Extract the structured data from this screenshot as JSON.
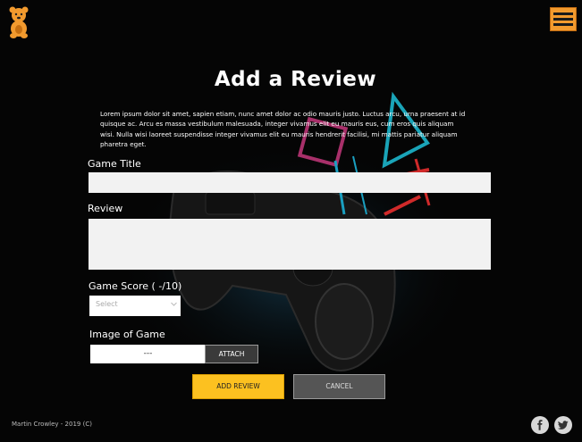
{
  "header": {
    "logo_icon": "bear-logo-icon",
    "menu_icon": "hamburger-menu-icon",
    "accent_color": "#f29a2e"
  },
  "page": {
    "title": "Add a Review",
    "intro": "Lorem ipsum dolor sit amet, sapien etiam, nunc amet dolor ac odio mauris justo. Luctus arcu, urna praesent at id quisque ac. Arcu es massa vestibulum malesuada, integer vivamus elit eu mauris eus, cum eros quis aliquam wisi. Nulla wisi laoreet suspendisse integer vivamus elit eu mauris hendrerit facilisi, mi mattis pariatur aliquam pharetra eget."
  },
  "form": {
    "game_title_label": "Game Title",
    "game_title_value": "",
    "review_label": "Review",
    "review_value": "",
    "score_label": "Game Score ( -/10)",
    "score_selected": "Select",
    "image_label": "Image of Game",
    "file_name": "---",
    "attach_label": "ATTACH",
    "add_label": "ADD REVIEW",
    "cancel_label": "CANCEL",
    "add_color": "#fcc120",
    "cancel_color": "#555555"
  },
  "footer": {
    "copyright": "Martin Crowley - 2019 (C)",
    "social_icons": [
      "facebook-icon",
      "twitter-icon"
    ]
  }
}
